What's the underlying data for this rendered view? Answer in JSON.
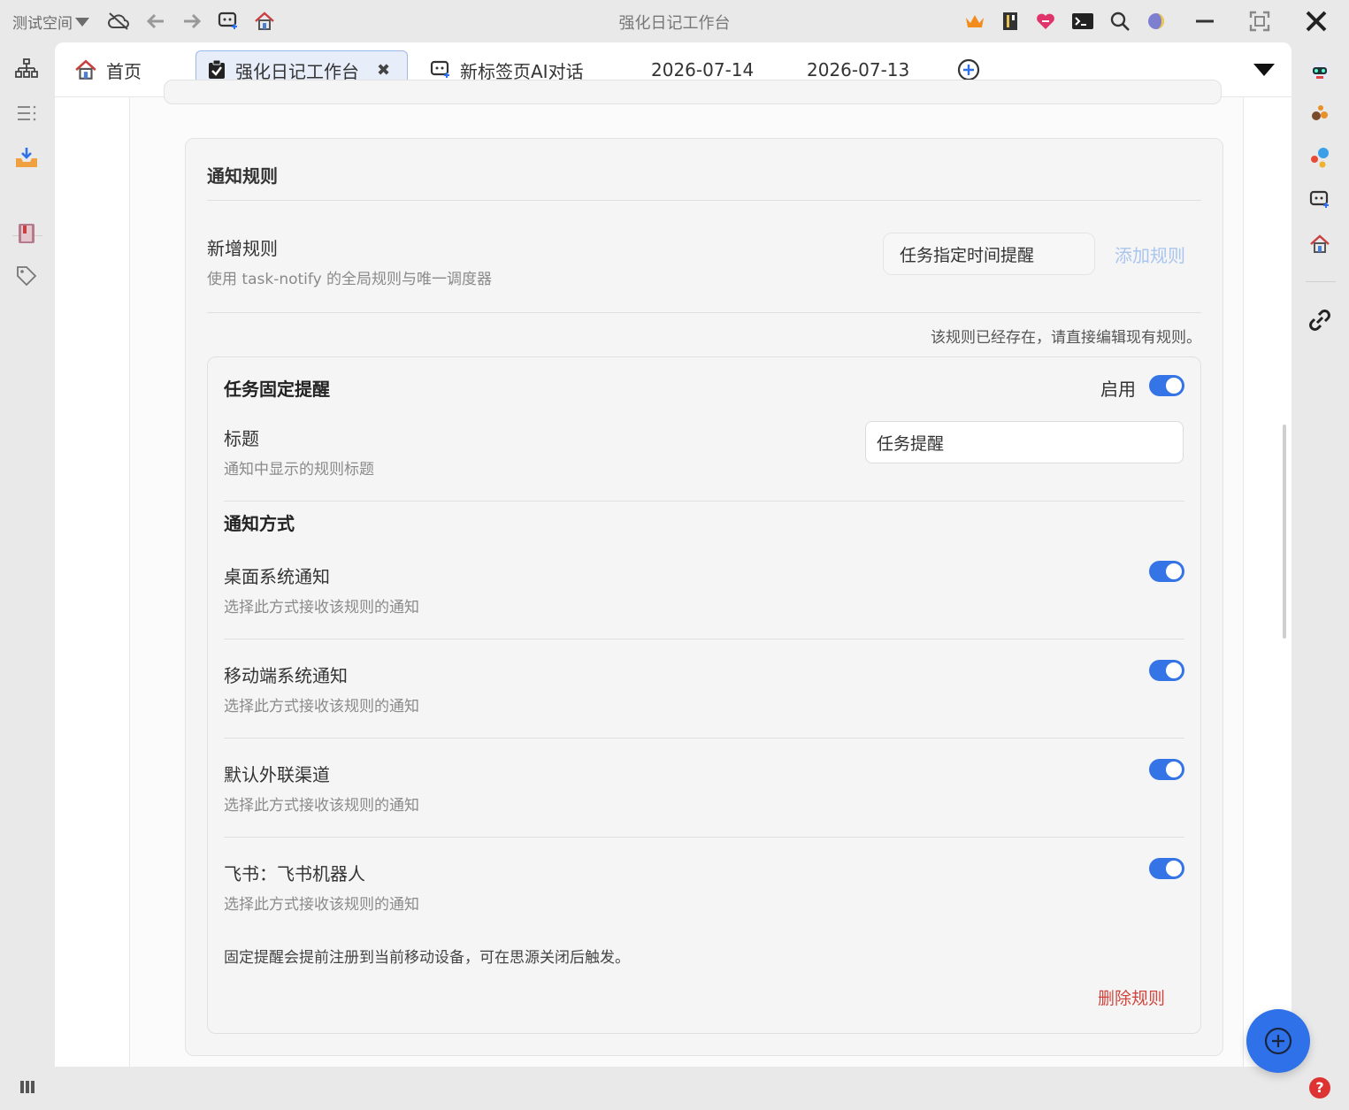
{
  "window": {
    "workspace": "测试空间",
    "app_title": "强化日记工作台"
  },
  "tabs": [
    {
      "label": "首页",
      "icon": "home-icon"
    },
    {
      "label": "强化日记工作台",
      "icon": "clipboard-check-icon",
      "active": true
    },
    {
      "label": "新标签页AI对话",
      "icon": "ai-chat-icon"
    },
    {
      "label": "2026-07-14"
    },
    {
      "label": "2026-07-13"
    }
  ],
  "settings": {
    "card_title": "通知规则",
    "new_rule": {
      "label": "新增规则",
      "description": "使用 task-notify 的全局规则与唯一调度器",
      "selected_option": "任务指定时间提醒",
      "add_button": "添加规则",
      "exists_note": "该规则已经存在，请直接编辑现有规则。"
    },
    "rule": {
      "name": "任务固定提醒",
      "enable_label": "启用",
      "enabled": true,
      "title_label": "标题",
      "title_description": "通知中显示的规则标题",
      "title_value": "任务提醒",
      "methods_title": "通知方式",
      "methods": [
        {
          "label": "桌面系统通知",
          "description": "选择此方式接收该规则的通知",
          "enabled": true
        },
        {
          "label": "移动端系统通知",
          "description": "选择此方式接收该规则的通知",
          "enabled": true
        },
        {
          "label": "默认外联渠道",
          "description": "选择此方式接收该规则的通知",
          "enabled": true
        },
        {
          "label": "飞书：飞书机器人",
          "description": "选择此方式接收该规则的通知",
          "enabled": true
        }
      ],
      "note": "固定提醒会提前注册到当前移动设备，可在思源关闭后触发。",
      "delete_button": "删除规则"
    }
  },
  "colors": {
    "accent": "#3474e6",
    "danger": "#d0463e",
    "link_disabled": "#a9c5ee"
  }
}
